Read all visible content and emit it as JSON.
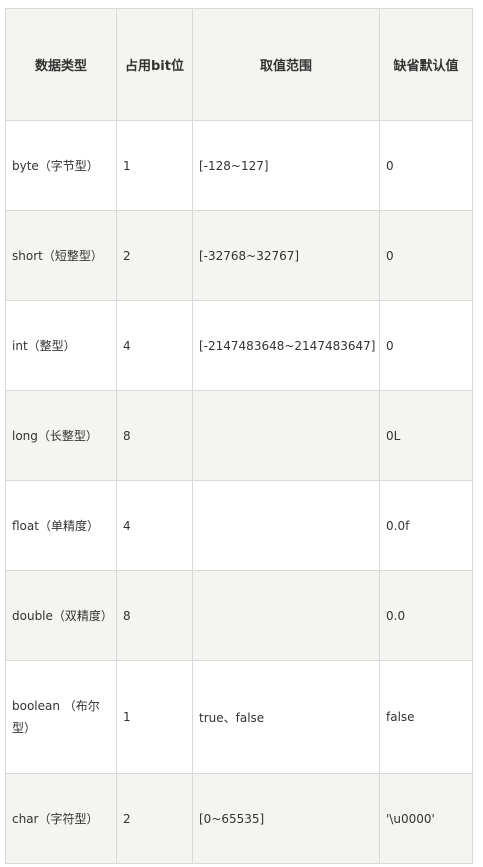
{
  "headers": [
    "数据类型",
    "占用bit位",
    "取值范围",
    "缺省默认值"
  ],
  "rows": [
    {
      "type": "byte（字节型）",
      "bits": "1",
      "range": "[-128~127]",
      "default": "0"
    },
    {
      "type": "short（短整型）",
      "bits": "2",
      "range": "[-32768~32767]",
      "default": "0"
    },
    {
      "type": "int（整型）",
      "bits": "4",
      "range": "[-2147483648~2147483647]",
      "default": "0"
    },
    {
      "type": "long（长整型）",
      "bits": "8",
      "range": "",
      "default": "0L"
    },
    {
      "type": "float（单精度）",
      "bits": "4",
      "range": "",
      "default": "0.0f"
    },
    {
      "type": "double（双精度）",
      "bits": "8",
      "range": "",
      "default": "0.0"
    },
    {
      "type": "boolean （布尔型）",
      "bits": "1",
      "range": "true、false",
      "default": "false"
    },
    {
      "type": "char（字符型）",
      "bits": "2",
      "range": "[0~65535]",
      "default": "'\\u0000'"
    }
  ]
}
